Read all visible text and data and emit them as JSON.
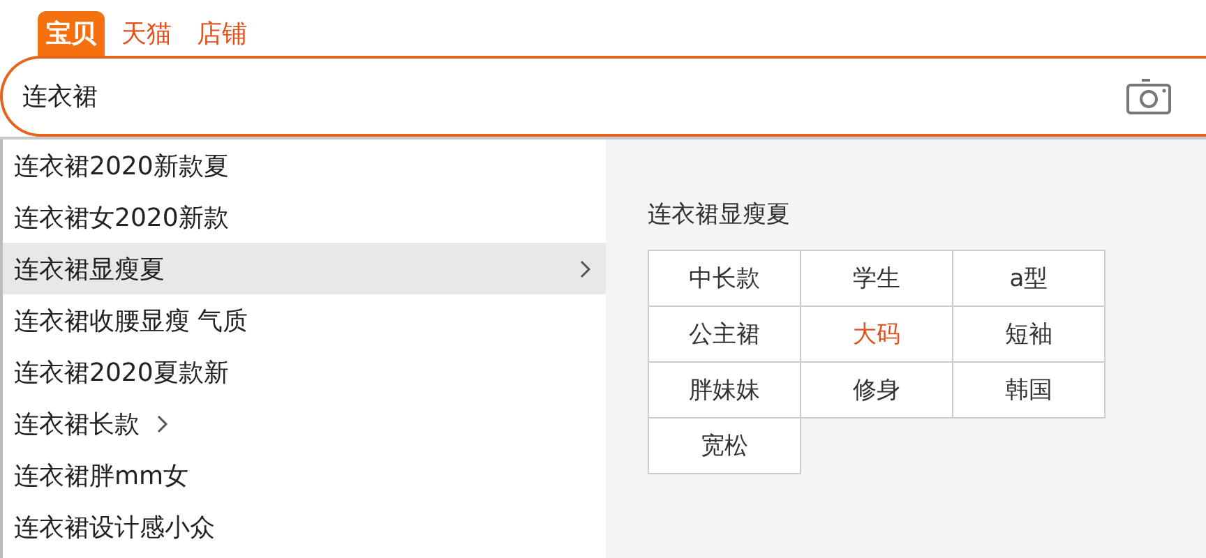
{
  "tabs": [
    {
      "label": "宝贝",
      "selected": true
    },
    {
      "label": "天猫",
      "selected": false
    },
    {
      "label": "店铺",
      "selected": false
    }
  ],
  "search": {
    "value": "连衣裙"
  },
  "suggestions": [
    {
      "label": "连衣裙2020新款夏",
      "selected": false,
      "expandable": false
    },
    {
      "label": "连衣裙女2020新款",
      "selected": false,
      "expandable": false
    },
    {
      "label": "连衣裙显瘦夏",
      "selected": true,
      "expandable": true
    },
    {
      "label": "连衣裙收腰显瘦 气质",
      "selected": false,
      "expandable": false
    },
    {
      "label": "连衣裙2020夏款新",
      "selected": false,
      "expandable": false
    },
    {
      "label": "连衣裙长款",
      "selected": false,
      "expandable": true
    },
    {
      "label": "连衣裙胖mm女",
      "selected": false,
      "expandable": false
    },
    {
      "label": "连衣裙设计感小众",
      "selected": false,
      "expandable": false
    }
  ],
  "detail": {
    "title": "连衣裙显瘦夏",
    "tags": [
      {
        "label": "中长款",
        "highlighted": false
      },
      {
        "label": "学生",
        "highlighted": false
      },
      {
        "label": "a型",
        "highlighted": false
      },
      {
        "label": "公主裙",
        "highlighted": false
      },
      {
        "label": "大码",
        "highlighted": true
      },
      {
        "label": "短袖",
        "highlighted": false
      },
      {
        "label": "胖妹妹",
        "highlighted": false
      },
      {
        "label": "修身",
        "highlighted": false
      },
      {
        "label": "韩国",
        "highlighted": false
      },
      {
        "label": "宽松",
        "highlighted": false
      }
    ]
  }
}
